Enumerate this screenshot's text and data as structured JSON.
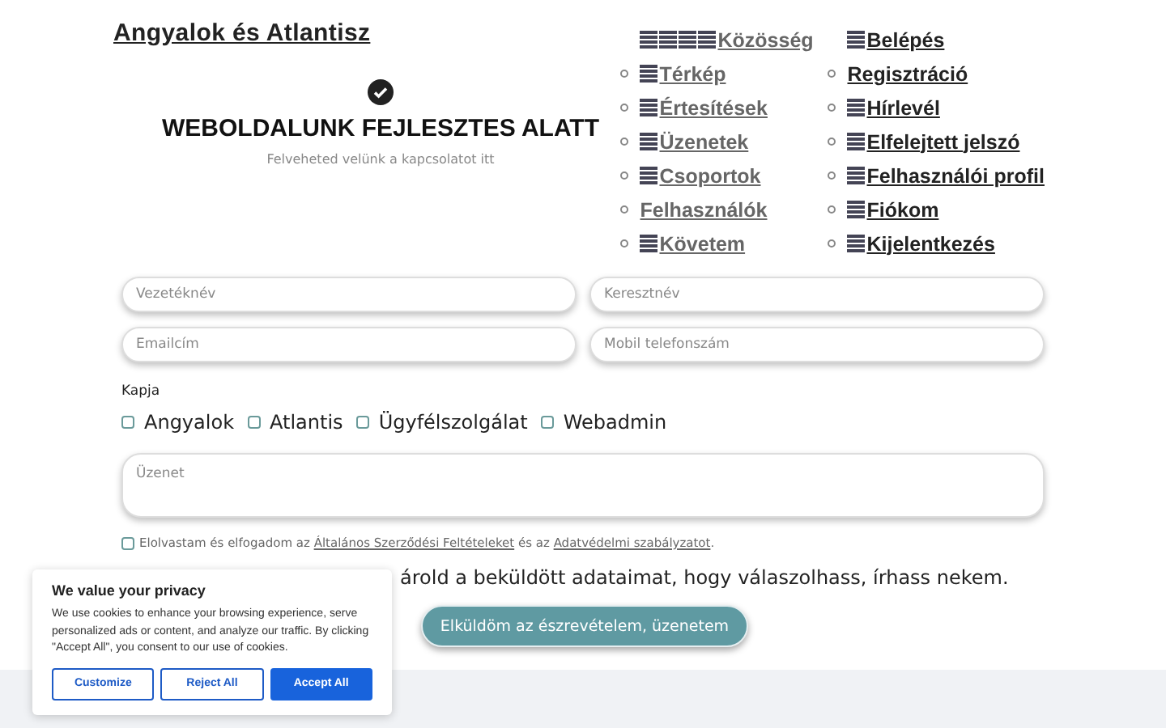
{
  "site_title": "Angyalok és Atlantisz",
  "menu": {
    "columns": [
      {
        "items": [
          {
            "label": "Közösség",
            "bullet": false,
            "kind": "multi-icon"
          },
          {
            "label": "Térkép",
            "bullet": true,
            "kind": "icon"
          },
          {
            "label": "Értesítések",
            "bullet": true,
            "kind": "icon"
          },
          {
            "label": "Üzenetek",
            "bullet": true,
            "kind": "icon"
          },
          {
            "label": "Csoportok",
            "bullet": true,
            "kind": "icon"
          },
          {
            "label": "Felhasználók",
            "bullet": true,
            "kind": "plain"
          },
          {
            "label": "Követem",
            "bullet": true,
            "kind": "icon"
          }
        ]
      },
      {
        "items": [
          {
            "label": "Belépés",
            "bullet": false,
            "kind": "icon"
          },
          {
            "label": "Regisztráció",
            "bullet": true,
            "kind": "plain"
          },
          {
            "label": "Hírlevél",
            "bullet": true,
            "kind": "icon"
          },
          {
            "label": "Elfelejtett jelszó",
            "bullet": true,
            "kind": "icon"
          },
          {
            "label": "Felhasználói profil",
            "bullet": true,
            "kind": "icon"
          },
          {
            "label": "Fiókom",
            "bullet": true,
            "kind": "icon"
          },
          {
            "label": "Kijelentkezés",
            "bullet": true,
            "kind": "icon"
          }
        ]
      }
    ]
  },
  "heading": "WEBOLDALUNK FEJLESZTES ALATT",
  "subheading": "Felveheted velünk a kapcsolatot itt",
  "fields": [
    {
      "placeholder": "Vezetéknév"
    },
    {
      "placeholder": "Keresztnév"
    },
    {
      "placeholder": "Emailcím"
    },
    {
      "placeholder": "Mobil telefonszám"
    }
  ],
  "recipients": {
    "label": "Kapja",
    "options": [
      {
        "label": "Angyalok",
        "checked": false
      },
      {
        "label": "Atlantis",
        "checked": false
      },
      {
        "label": "Ügyfélszolgálat",
        "checked": false
      },
      {
        "label": "Webadmin",
        "checked": false
      }
    ]
  },
  "message": {
    "placeholder": "Üzenet"
  },
  "terms": {
    "checked": false,
    "before": "Elolvastam és elfogadom az",
    "link1": "Általános Szerződési Feltételeket",
    "middle": "és az",
    "link2": "Adatvédelmi szabályzatot",
    "after": "."
  },
  "consent_text": "árold a beküldött adataimat, hogy válaszolhass, írhass nekem.",
  "submit": "Elküldöm az észrevételem, üzenetem",
  "cookie": {
    "title": "We value your privacy",
    "body": "We use cookies to enhance your browsing experience, serve personalized ads or content, and analyze our traffic. By clicking \"Accept All\", you consent to our use of cookies.",
    "buttons": [
      {
        "label": "Customize",
        "kind": "outline"
      },
      {
        "label": "Reject All",
        "kind": "outline"
      },
      {
        "label": "Accept All",
        "kind": "primary"
      }
    ]
  }
}
